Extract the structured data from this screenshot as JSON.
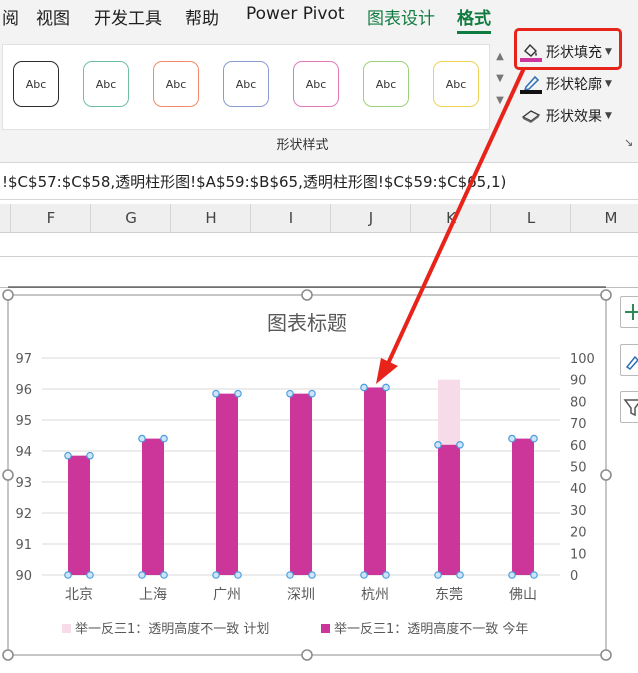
{
  "ribbon": {
    "tabs": [
      "阅",
      "视图",
      "开发工具",
      "帮助",
      "Power Pivot",
      "图表设计",
      "格式"
    ],
    "active_tab": "格式",
    "shape_styles": {
      "group_label": "形状样式",
      "sample_text": "Abc",
      "border_colors": [
        "#2b2b2b",
        "#6fbf9f",
        "#f08a6a",
        "#8a9bd2",
        "#e27ab8",
        "#9cd07a",
        "#f0d25a"
      ]
    },
    "commands": {
      "fill": "形状填充",
      "outline": "形状轮廓",
      "effects": "形状效果"
    }
  },
  "formula_bar": {
    "text": "!$C$57:$C$58,透明柱形图!$A$59:$B$65,透明柱形图!$C$59:$C$65,1)"
  },
  "columns": [
    "F",
    "G",
    "H",
    "I",
    "J",
    "K",
    "L",
    "M"
  ],
  "colors": {
    "accent_green": "#107c41",
    "series_plan": "#f7dbe9",
    "series_this_year": "#cc3599",
    "annotation_red": "#e8231a",
    "handle_blue": "#4a9ee0"
  },
  "chart_data": {
    "type": "bar",
    "title": "图表标题",
    "categories": [
      "北京",
      "上海",
      "广州",
      "深圳",
      "杭州",
      "东莞",
      "佛山"
    ],
    "series": [
      {
        "name": "举一反三1：透明高度不一致 计划",
        "axis": "secondary",
        "values": [
          0,
          0,
          0,
          0,
          0,
          90,
          0
        ]
      },
      {
        "name": "举一反三1：透明高度不一致 今年",
        "axis": "primary",
        "values": [
          93.85,
          94.4,
          95.85,
          95.85,
          96.05,
          94.2,
          94.4
        ]
      }
    ],
    "y_primary": {
      "min": 90,
      "max": 97,
      "ticks": [
        90,
        91,
        92,
        93,
        94,
        95,
        96,
        97
      ]
    },
    "y_secondary": {
      "min": 0,
      "max": 100,
      "ticks": [
        0,
        10,
        20,
        30,
        40,
        50,
        60,
        70,
        80,
        90,
        100
      ]
    },
    "grid": true,
    "legend": "bottom"
  }
}
